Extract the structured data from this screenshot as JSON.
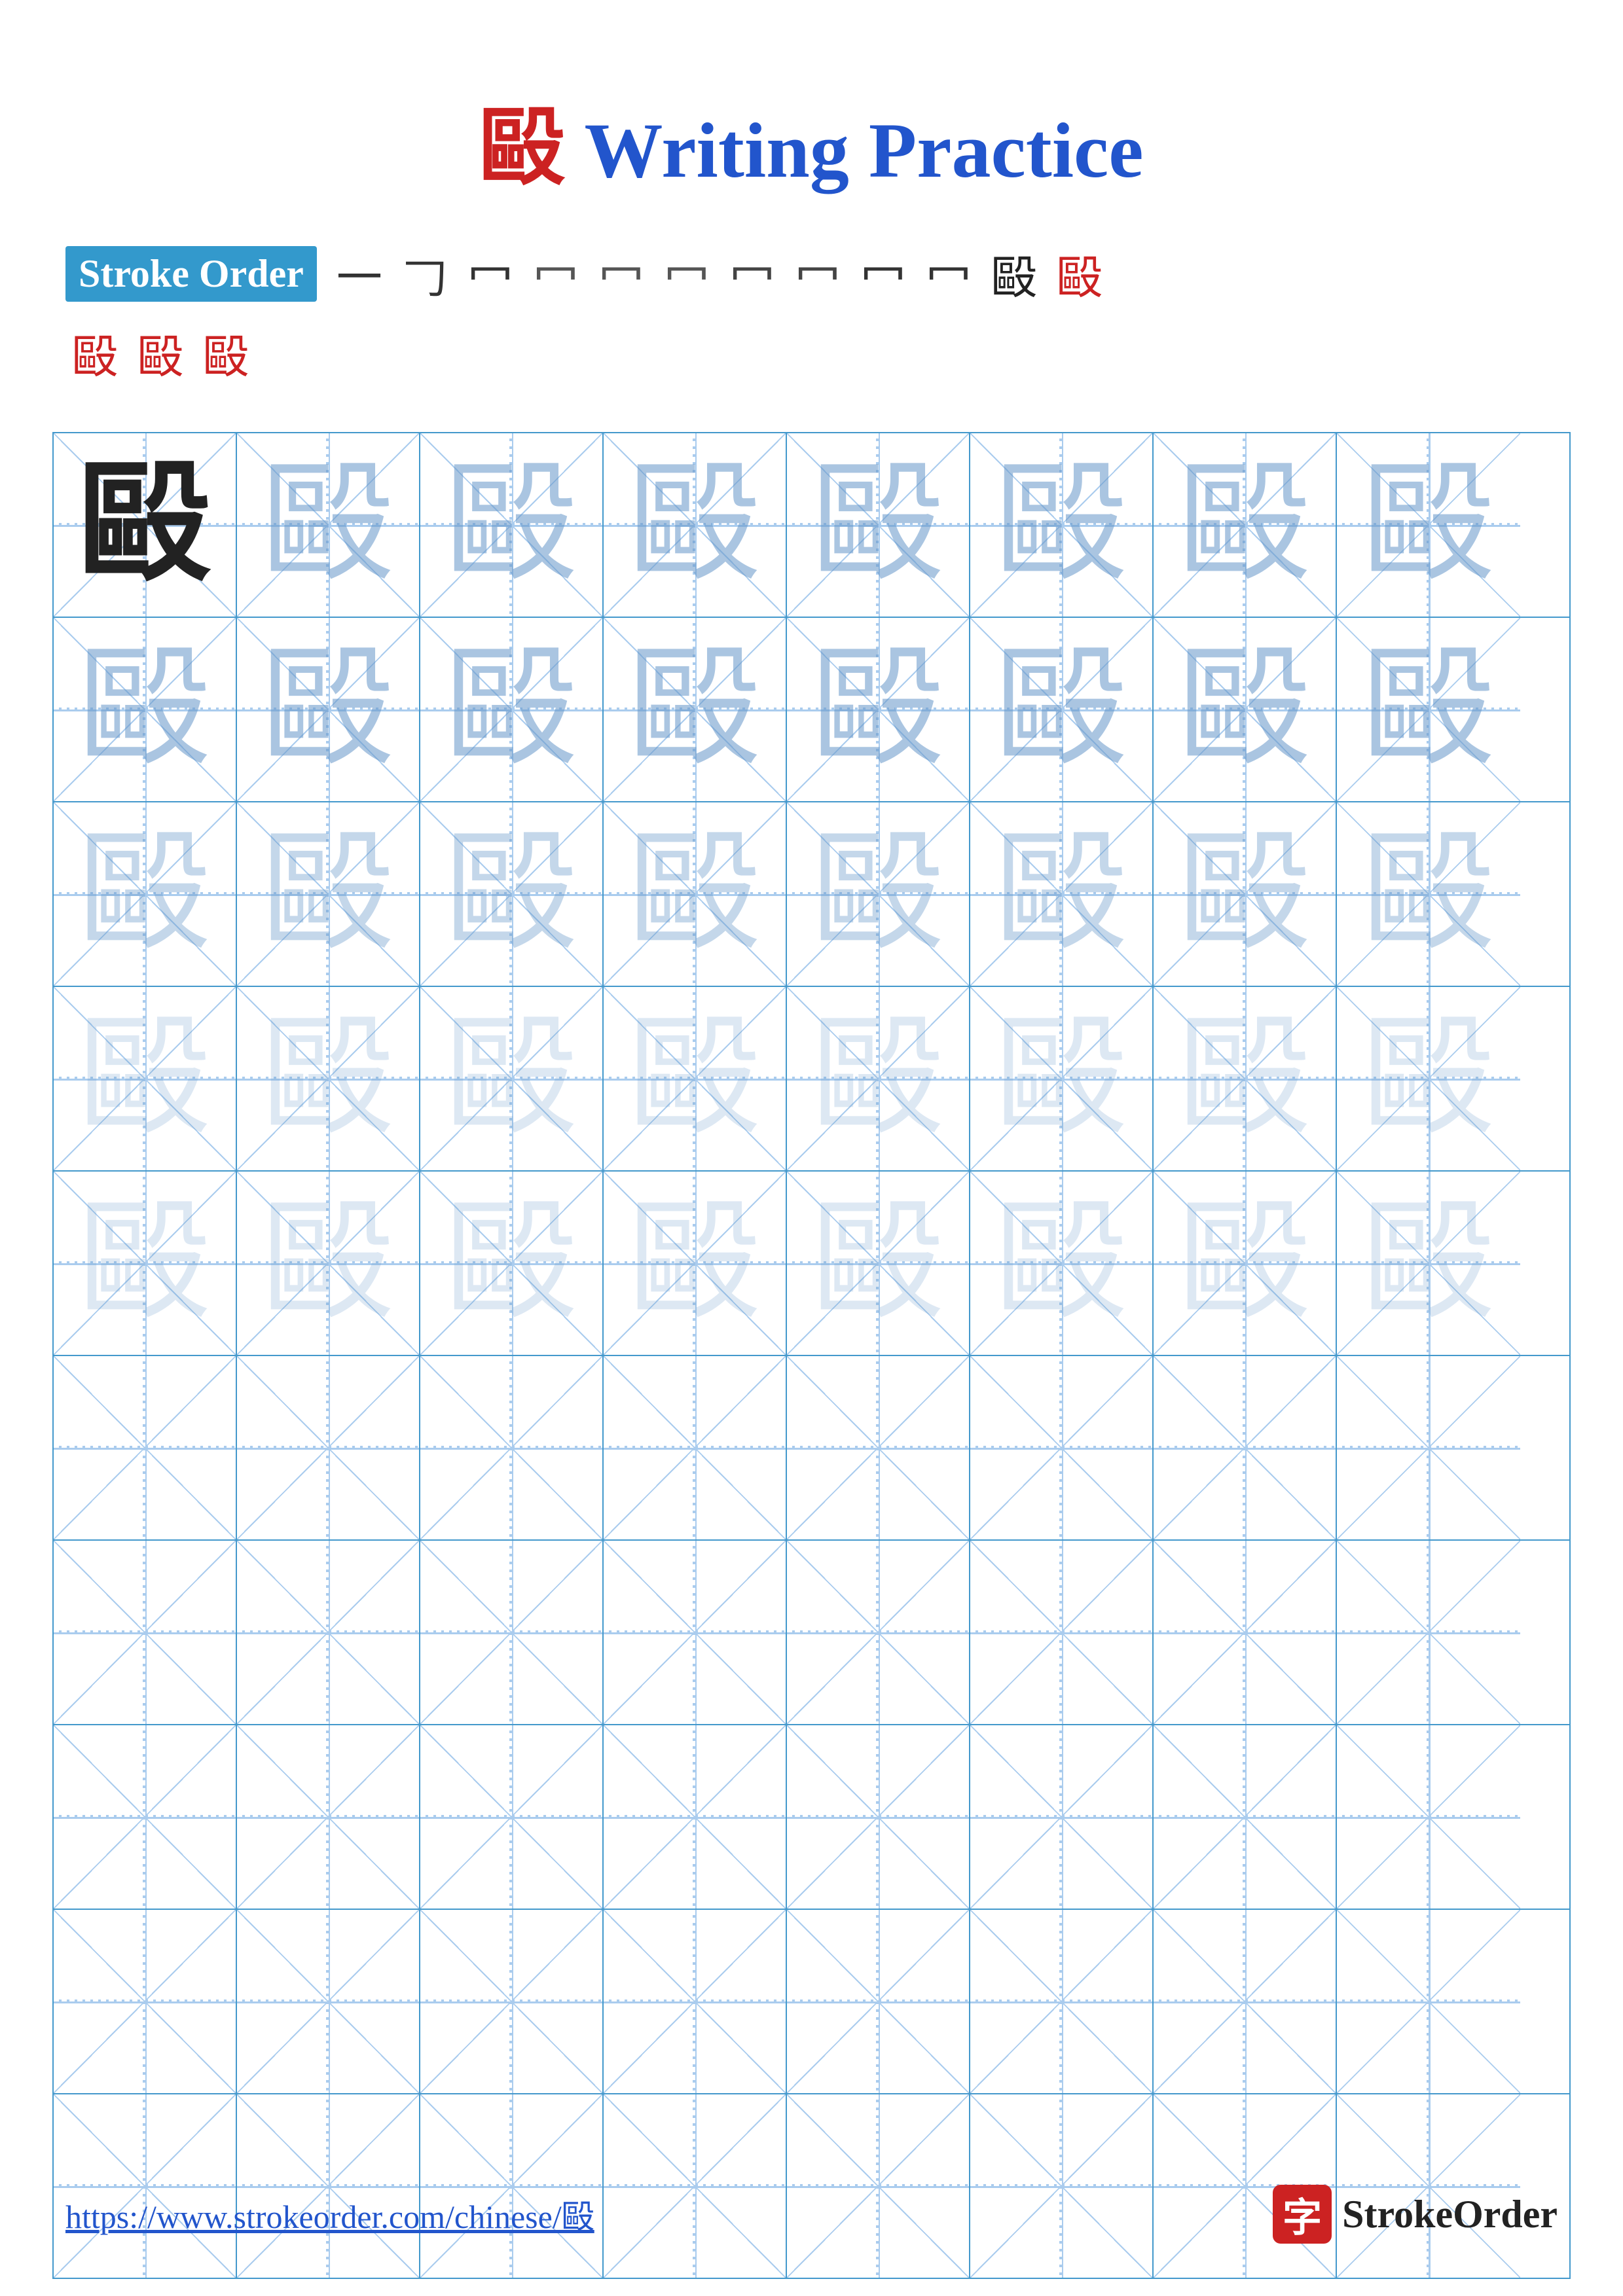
{
  "title": {
    "char": "毆",
    "text": " Writing Practice",
    "color_char": "#cc2222",
    "color_text": "#2255cc"
  },
  "stroke_order": {
    "label": "Stroke Order",
    "strokes": [
      "一",
      "𠃌",
      "冖",
      "冖",
      "冖",
      "冖",
      "冖",
      "冖",
      "冖",
      "冖",
      "毆",
      "毆"
    ],
    "row2": [
      "毆",
      "毆",
      "毆"
    ]
  },
  "grid": {
    "rows": 10,
    "cols": 8,
    "char": "毆",
    "practice_rows_dark": 1,
    "practice_rows_light1": 1,
    "practice_rows_light2": 1,
    "practice_rows_light3": 2,
    "practice_rows_empty": 5
  },
  "footer": {
    "url": "https://www.strokeorder.com/chinese/毆",
    "brand": "StrokeOrder",
    "brand_char": "字"
  }
}
